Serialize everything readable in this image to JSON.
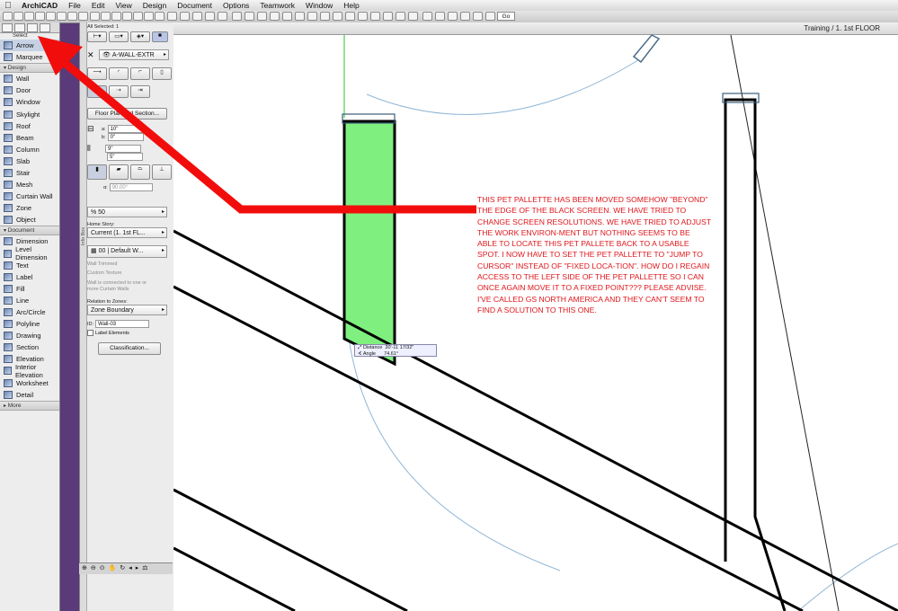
{
  "menubar": {
    "app_name": "ArchiCAD",
    "items": [
      "File",
      "Edit",
      "View",
      "Design",
      "Document",
      "Options",
      "Teamwork",
      "Window",
      "Help"
    ]
  },
  "toolbar": {
    "go_label": "Go"
  },
  "toolbox": {
    "select_label": "Select",
    "sections": {
      "select": [
        {
          "label": "Arrow",
          "icon": "arrow-pointer-icon",
          "selected": true
        },
        {
          "label": "Marquee",
          "icon": "marquee-icon",
          "selected": false
        }
      ],
      "design_header": "Design",
      "design": [
        {
          "label": "Wall",
          "icon": "wall-icon"
        },
        {
          "label": "Door",
          "icon": "door-icon"
        },
        {
          "label": "Window",
          "icon": "window-icon"
        },
        {
          "label": "Skylight",
          "icon": "skylight-icon"
        },
        {
          "label": "Roof",
          "icon": "roof-icon"
        },
        {
          "label": "Beam",
          "icon": "beam-icon"
        },
        {
          "label": "Column",
          "icon": "column-icon"
        },
        {
          "label": "Slab",
          "icon": "slab-icon"
        },
        {
          "label": "Stair",
          "icon": "stair-icon"
        },
        {
          "label": "Mesh",
          "icon": "mesh-icon"
        },
        {
          "label": "Curtain Wall",
          "icon": "curtain-wall-icon"
        },
        {
          "label": "Zone",
          "icon": "zone-icon"
        },
        {
          "label": "Object",
          "icon": "object-icon"
        }
      ],
      "document_header": "Document",
      "document": [
        {
          "label": "Dimension",
          "icon": "dimension-icon"
        },
        {
          "label": "Level Dimension",
          "icon": "level-dimension-icon"
        },
        {
          "label": "Text",
          "icon": "text-icon"
        },
        {
          "label": "Label",
          "icon": "label-icon"
        },
        {
          "label": "Fill",
          "icon": "fill-icon"
        },
        {
          "label": "Line",
          "icon": "line-icon"
        },
        {
          "label": "Arc/Circle",
          "icon": "arc-circle-icon"
        },
        {
          "label": "Polyline",
          "icon": "polyline-icon"
        },
        {
          "label": "Drawing",
          "icon": "drawing-icon"
        },
        {
          "label": "Section",
          "icon": "section-icon"
        },
        {
          "label": "Elevation",
          "icon": "elevation-icon"
        },
        {
          "label": "Interior Elevation",
          "icon": "interior-elevation-icon"
        },
        {
          "label": "Worksheet",
          "icon": "worksheet-icon"
        },
        {
          "label": "Detail",
          "icon": "detail-icon"
        }
      ],
      "more_header": "More"
    }
  },
  "infobox": {
    "strip_label": "Info Box",
    "all_selected": "All Selected: 1",
    "layer": "A-WALL-EXTR",
    "floor_plan_btn": "Floor Plan and Section...",
    "height_a_label": "a:",
    "height_a": "10\"",
    "height_b_label": "b:",
    "height_b": "0\"",
    "thick_1": "9\"",
    "thick_2": "5\"",
    "angle": "90.00°",
    "angle_label": "α:",
    "pen_pct": "% 50",
    "home_story_label": "Home Story:",
    "home_story": "Current (1. 1st FL...",
    "profile": "00 | Default W...",
    "wall_trimmed": "Wall Trimmed",
    "custom_texture": "Custom Texture",
    "curtain_note": "Wall is connected to one or more Curtain Walls",
    "relation_label": "Relation to Zones:",
    "relation": "Zone Boundary",
    "id_label": "ID:",
    "id_value": "Wall-03",
    "label_elements": "Label Elements",
    "classification_btn": "Classification..."
  },
  "canvas": {
    "title": "Training / 1. 1st FLOOR",
    "tracker": {
      "distance_label": "Distance",
      "distance": "30'-11 17/32\"",
      "angle_label": "Angle",
      "angle": "74.61°"
    },
    "annotation": "THIS PET PALLETTE HAS BEEN MOVED SOMEHOW \"BEYOND\" THE EDGE OF THE BLACK SCREEN. WE HAVE TRIED TO CHANGE SCREEN RESOLUTIONS. WE HAVE TRIED TO ADJUST THE WORK ENVIRON-MENT BUT NOTHING SEEMS TO BE ABLE TO LOCATE THIS PET PALLETE BACK TO A USABLE SPOT. I NOW HAVE TO SET THE PET PALLETTE TO \"JUMP TO CURSOR\" INSTEAD OF \"FIXED LOCA-TION\". HOW DO I REGAIN ACCESS TO THE LEFT SIDE OF THE PET PALLETTE SO I CAN ONCE AGAIN MOVE IT TO A FIXED POINT??? PLEASE ADVISE. I'VE CALLED GS NORTH AMERICA AND THEY CAN'T SEEM TO FIND A SOLUTION TO THIS ONE.",
    "annotation_color": "#e0161b",
    "selected_wall_color": "#7ff07f"
  }
}
